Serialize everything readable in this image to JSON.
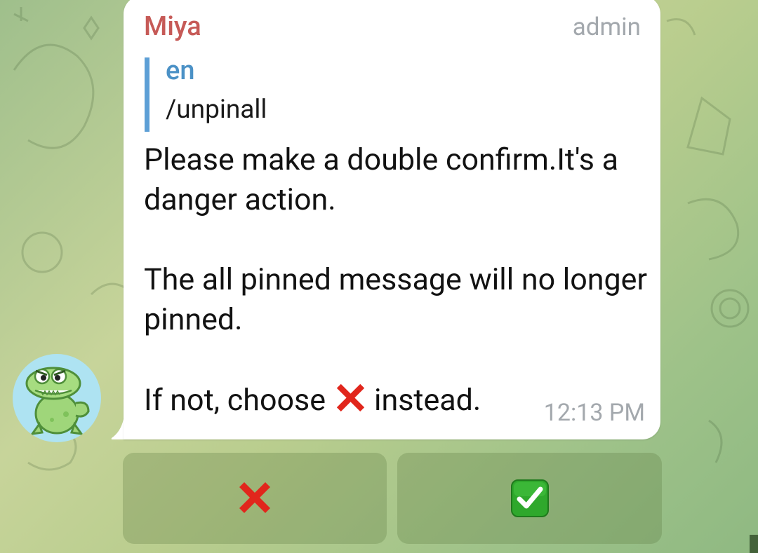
{
  "message": {
    "sender": "Miya",
    "role": "admin",
    "reply": {
      "author": "en",
      "text": "/unpinall"
    },
    "paragraphs": [
      "Please make a double confirm.It's a danger action.",
      "The all pinned message will no longer pinned."
    ],
    "last_line_before": "If not, choose",
    "last_line_after": "instead.",
    "time": "12:13 PM"
  },
  "keyboard": {
    "buttons": [
      {
        "label": "❌",
        "icon": "cross-mark-icon"
      },
      {
        "label": "✅",
        "icon": "check-mark-icon"
      }
    ]
  },
  "colors": {
    "sender": "#c65a57",
    "reply_accent": "#5d9fd6",
    "button_bg": "#5a783c",
    "avatar_bg": "#aee3f2"
  }
}
